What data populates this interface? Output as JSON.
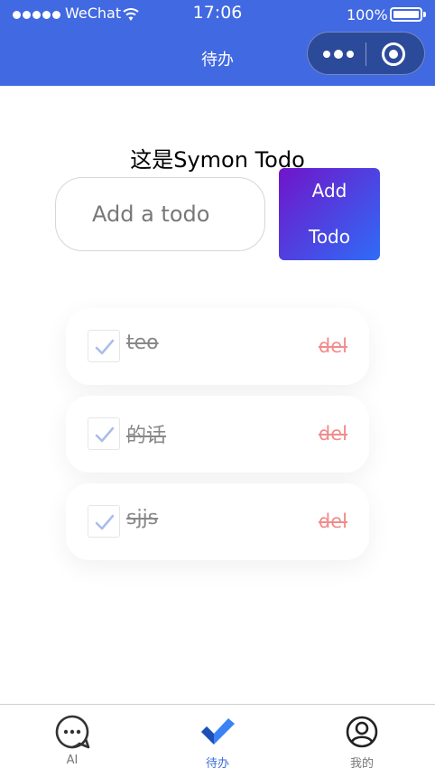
{
  "status_bar": {
    "carrier": "WeChat",
    "time": "17:06",
    "battery": "100%",
    "battery_level": 1.0
  },
  "nav": {
    "title": "待办"
  },
  "main": {
    "title": "这是Symon Todo",
    "input": {
      "placeholder": "Add a todo",
      "value": ""
    },
    "add_button": {
      "line1": "Add",
      "line2": "Todo"
    },
    "todos": [
      {
        "text": "teo",
        "done": true,
        "delete_label": "del"
      },
      {
        "text": "的话",
        "done": true,
        "delete_label": "del"
      },
      {
        "text": "sjjs",
        "done": true,
        "delete_label": "del"
      }
    ]
  },
  "tab_bar": {
    "tabs": [
      {
        "label": "AI",
        "icon": "chat-bubble-icon",
        "active": false
      },
      {
        "label": "待办",
        "icon": "double-check-icon",
        "active": true
      },
      {
        "label": "我的",
        "icon": "user-icon",
        "active": false
      }
    ]
  },
  "colors": {
    "header": "#4169e1",
    "accent": "#3b6fd4",
    "button_gradient_start": "#7015c9",
    "button_gradient_end": "#2f6cf7",
    "delete": "#f28b8b"
  }
}
